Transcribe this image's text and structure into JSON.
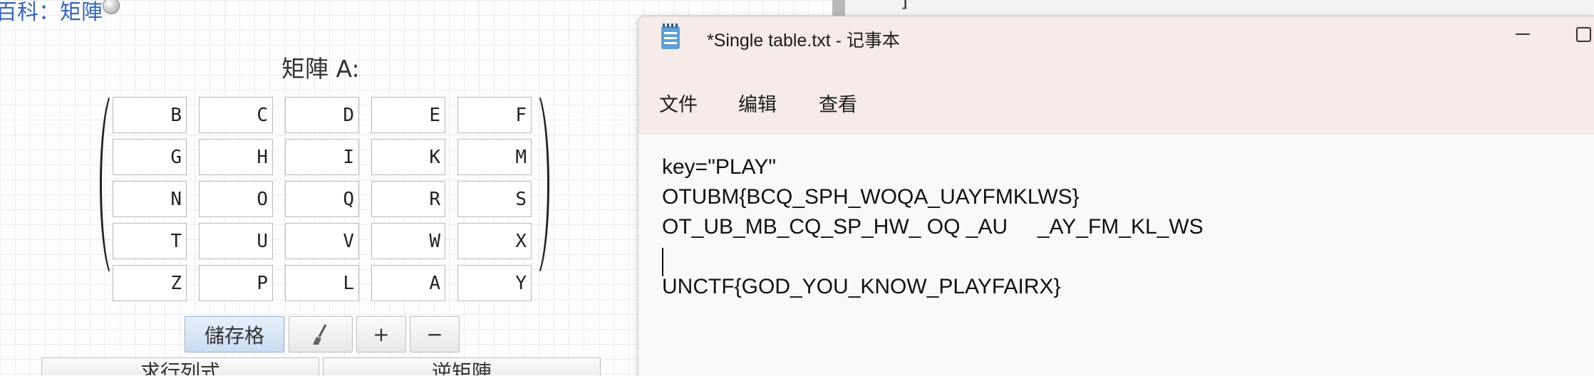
{
  "matrix_page": {
    "heading": "百科：矩陣",
    "matrix_title": "矩陣 A:",
    "matrix_rows": [
      [
        "B",
        "C",
        "D",
        "E",
        "F"
      ],
      [
        "G",
        "H",
        "I",
        "K",
        "M"
      ],
      [
        "N",
        "O",
        "Q",
        "R",
        "S"
      ],
      [
        "T",
        "U",
        "V",
        "W",
        "X"
      ],
      [
        "Z",
        "P",
        "L",
        "A",
        "Y"
      ]
    ],
    "buttons": {
      "store": "儲存格",
      "clear_icon": "brush-icon",
      "plus": "+",
      "minus": "−",
      "determinant": "求行列式",
      "inverse": "逆矩陣"
    }
  },
  "background_window": {
    "bracket_text": "]"
  },
  "notepad": {
    "title": "*Single table.txt - 记事本",
    "icon": "notepad-icon",
    "menu": [
      "文件",
      "编辑",
      "查看"
    ],
    "lines": [
      "key=\"PLAY\"",
      "OTUBM{BCQ_SPH_WOQA_UAYFMKLWS}",
      "OT_UB_MB_CQ_SP_HW_ OQ _AU     _AY_FM_KL_WS",
      "",
      "UNCTF{GOD_YOU_KNOW_PLAYFAIRX}"
    ]
  },
  "colors": {
    "link_blue": "#3866b6",
    "titlebar_bg": "#f6ebe8",
    "store_button_bg": "#c9dcf2"
  }
}
